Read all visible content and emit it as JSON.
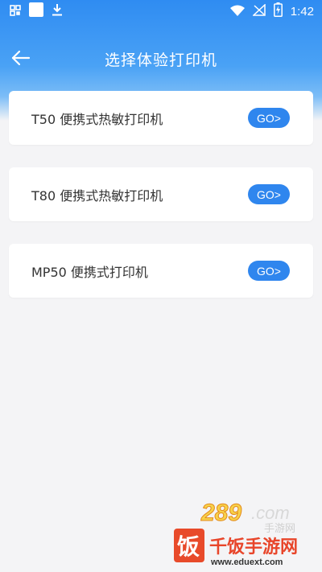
{
  "status_bar": {
    "time": "1:42",
    "icons": [
      "qr-code-icon",
      "app-placeholder-icon",
      "download-icon",
      "wifi-icon",
      "signal-icon",
      "battery-charging-icon"
    ]
  },
  "header": {
    "title": "选择体验打印机",
    "back_icon": "arrow-left-icon"
  },
  "printers": [
    {
      "label": "T50 便携式热敏打印机",
      "button": "GO>"
    },
    {
      "label": "T80 便携式热敏打印机",
      "button": "GO>"
    },
    {
      "label": "MP50 便携式打印机",
      "button": "GO>"
    }
  ],
  "watermark": {
    "text": "千饭手游网",
    "url": "www.eduext.com",
    "logo_text": "289.com 手游网"
  },
  "colors": {
    "header_top": "#2f8cf2",
    "accent": "#2f86ee",
    "background": "#f4f4f6"
  }
}
